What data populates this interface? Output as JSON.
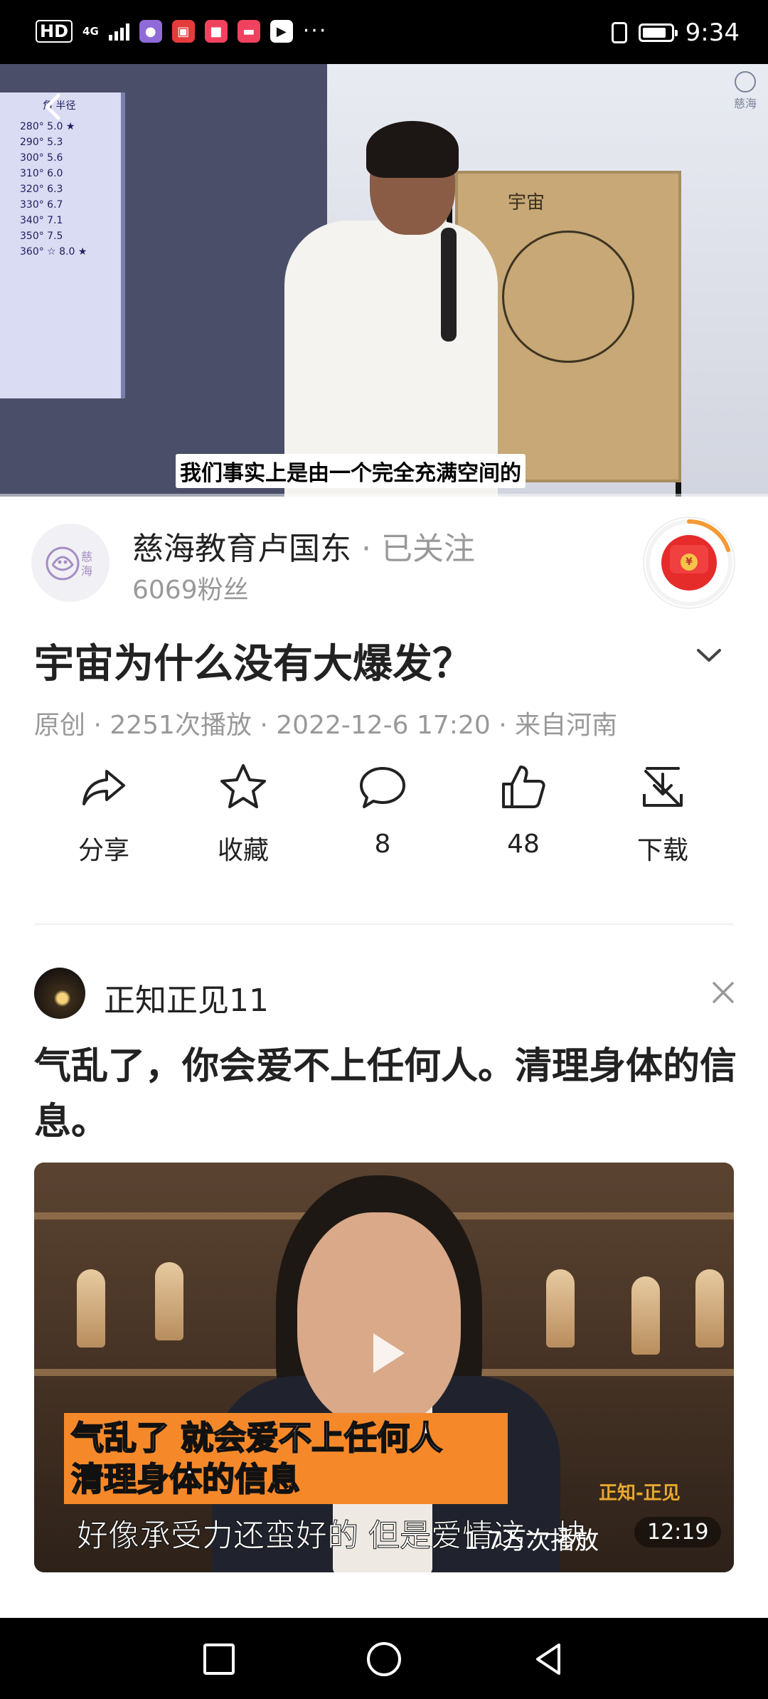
{
  "status_bar": {
    "time": "9:34",
    "hd_label": "HD",
    "network": "4G",
    "app_icons": [
      {
        "name": "app-icon-1",
        "color": "#8f6bd8"
      },
      {
        "name": "app-icon-2",
        "color": "#e63b3b"
      },
      {
        "name": "app-icon-3",
        "color": "#f0425e"
      },
      {
        "name": "app-icon-4",
        "color": "#f0425e"
      },
      {
        "name": "app-icon-5",
        "color": "#1c1c1c"
      }
    ],
    "more": "···",
    "battery_level": 0.85
  },
  "video": {
    "caption": "我们事实上是由一个完全充满空间的",
    "watermark": "慈海",
    "board_word": "宇宙",
    "slide_rows": [
      "280° 5.0 ★",
      "290° 5.3",
      "300° 5.6",
      "310° 6.0",
      "320° 6.3",
      "330° 6.7",
      "340° 7.1",
      "350° 7.5",
      "360° ☆ 8.0 ★"
    ],
    "slide_header": "角  半径"
  },
  "author": {
    "avatar_text": "慈海",
    "name": "慈海教育卢国东",
    "separator": "·",
    "follow_state": "已关注",
    "fans": "6069粉丝",
    "redpacket_coin": "¥"
  },
  "post": {
    "title": "宇宙为什么没有大爆发？",
    "meta": "原创 · 2251次播放 · 2022-12-6 17:20 · 来自河南"
  },
  "actions": [
    {
      "key": "share",
      "label": "分享"
    },
    {
      "key": "favorite",
      "label": "收藏"
    },
    {
      "key": "comment",
      "label": "8"
    },
    {
      "key": "like",
      "label": "48"
    },
    {
      "key": "download",
      "label": "下载"
    }
  ],
  "feed_item": {
    "poster_name": "正知正见11",
    "title": "气乱了，你会爱不上任何人。清理身体的信息。",
    "overlay_line1": "气乱了  就会爱不上任何人",
    "overlay_line2": "清理身体的信息",
    "watermark": "正知-正见",
    "subtitle": "好像承受力还蛮好的 但是爱情这一块",
    "views": "1.7万次播放",
    "duration": "12:19"
  },
  "colors": {
    "accent_red": "#e62b2b",
    "overlay_orange": "#f5892a",
    "meta_gray": "#999999"
  }
}
